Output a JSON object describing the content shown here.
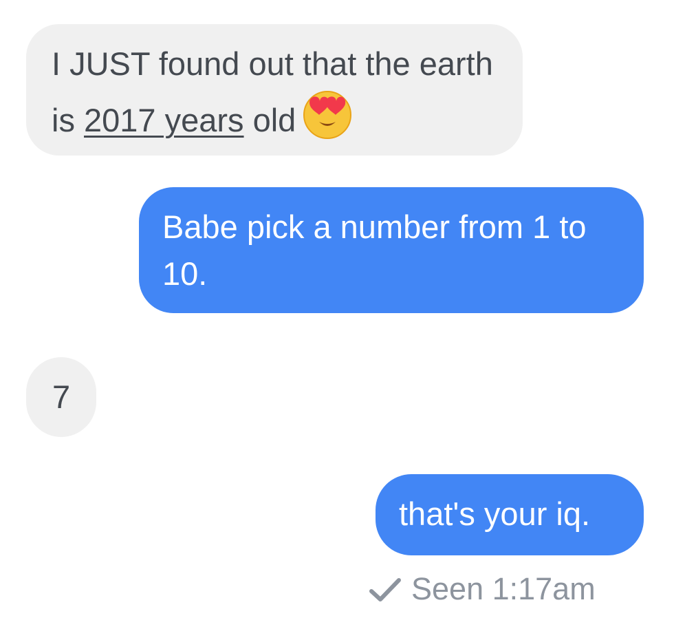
{
  "conversation": {
    "messages": [
      {
        "sender": "received",
        "text_before": "I JUST found out that the earth is ",
        "link_text": "2017 years",
        "text_after": " old",
        "emoji": "heart-eyes-face-icon"
      },
      {
        "sender": "sent",
        "text": "Babe pick a number from 1 to 10."
      },
      {
        "sender": "received",
        "text": "7"
      },
      {
        "sender": "sent",
        "text": "that's your iq."
      }
    ],
    "status": {
      "icon": "checkmark-icon",
      "label": "Seen 1:17am"
    }
  },
  "colors": {
    "received_bubble": "#f0f0f0",
    "received_text": "#444950",
    "sent_bubble": "#4286f5",
    "sent_text": "#ffffff",
    "status_text": "#8d949e"
  }
}
